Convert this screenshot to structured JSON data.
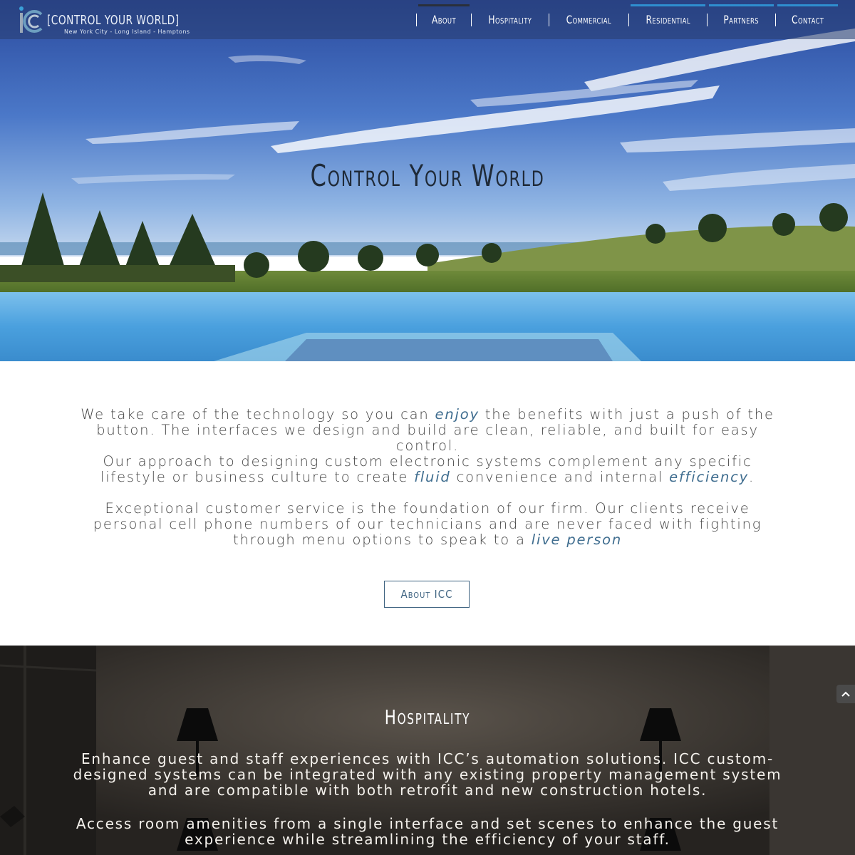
{
  "header": {
    "logo_title": "[CONTROL YOUR WORLD]",
    "logo_subtitle": "New York City - Long Island - Hamptons",
    "nav": [
      {
        "label": "About"
      },
      {
        "label": "Hospitality"
      },
      {
        "label": "Commercial"
      },
      {
        "label": "Residential"
      },
      {
        "label": "Partners"
      },
      {
        "label": "Contact"
      }
    ]
  },
  "hero": {
    "title": "Control Your World"
  },
  "intro": {
    "p1_a": "We take care of the technology so you can ",
    "p1_em": "enjoy",
    "p1_b": " the benefits with just a push of the button. The interfaces we design and build are clean, reliable, and built for easy control.",
    "p2_a": "Our approach to designing custom electronic systems complement any specific lifestyle or business culture to create ",
    "p2_em1": "fluid",
    "p2_b": " convenience and internal ",
    "p2_em2": "efficiency",
    "p2_c": ".",
    "p3_a": "Exceptional customer service is the foundation of our firm. Our clients receive personal cell phone numbers of our technicians and are never faced with fighting through menu options to speak to a ",
    "p3_em": "live person",
    "button": "About ICC"
  },
  "hospitality": {
    "title": "Hospitality",
    "p1": "Enhance guest and staff experiences with ICC’s automation solutions. ICC custom-designed systems can be integrated with any existing property management system and are compatible with both retrofit and new construction hotels.",
    "p2": "Access room amenities from a single interface and set scenes to enhance the guest experience while streamlining the efficiency of your staff."
  },
  "colors": {
    "accent": "#3f6d8f",
    "nav_bar": "#2f8fd0",
    "header_bg": "#2c3e6e"
  },
  "icons": {
    "scroll_top": "chevron-up-icon"
  }
}
